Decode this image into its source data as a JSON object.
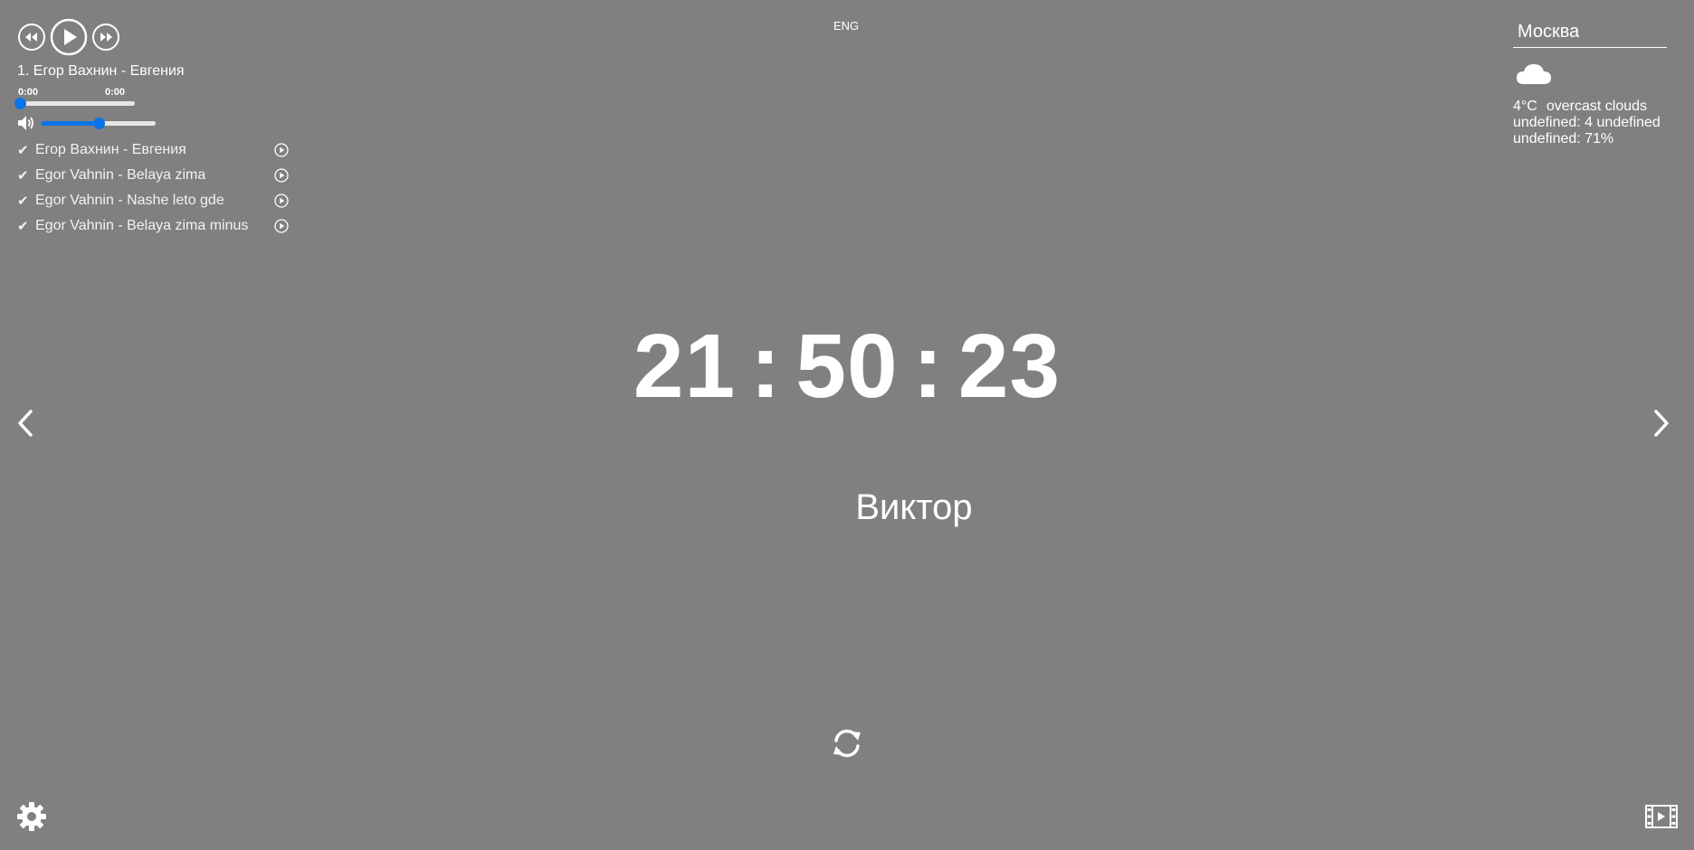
{
  "player": {
    "current_track": "1. Егор Вахнин - Евгения",
    "time_current": "0:00",
    "time_duration": "0:00",
    "progress_fraction": 0,
    "volume_fraction": 0.5,
    "playlist": [
      {
        "check": "✔",
        "title": "Егор Вахнин - Евгения"
      },
      {
        "check": "✔",
        "title": "Egor Vahnin - Belaya zima"
      },
      {
        "check": "✔",
        "title": "Egor Vahnin - Nashe leto gde"
      },
      {
        "check": "✔",
        "title": "Egor Vahnin - Belaya zima minus"
      }
    ],
    "icons": {
      "prev": "rewind-icon",
      "play": "play-icon",
      "next": "fast-forward-icon",
      "volume": "speaker-icon",
      "item_play": "play-circle-icon"
    }
  },
  "language": "ENG",
  "weather": {
    "city": "Москва",
    "icon": "cloud-icon",
    "temperature": "4°C",
    "description": "overcast clouds",
    "wind": "undefined: 4 undefined",
    "humidity": "undefined: 71%"
  },
  "clock": {
    "hours": "21",
    "minutes": "50",
    "seconds": "23",
    "separator": ":"
  },
  "greeting": {
    "name": "Виктор"
  },
  "icons": {
    "left": "chevron-left-icon",
    "right": "chevron-right-icon",
    "refresh": "refresh-icon",
    "settings": "gear-icon",
    "video": "film-icon"
  },
  "colors": {
    "background": "#808080",
    "accent": "#0a74e8",
    "text": "#ffffff"
  }
}
